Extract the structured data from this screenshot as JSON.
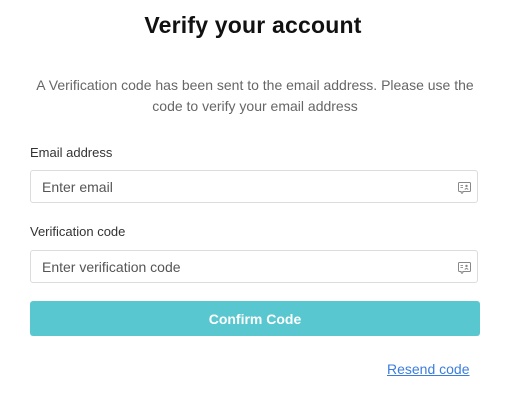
{
  "page": {
    "title": "Verify your account",
    "description": "A Verification code has been sent to the email address. Please use the code to verify your email address"
  },
  "form": {
    "email": {
      "label": "Email address",
      "placeholder": "Enter email",
      "value": "",
      "icon": "contact-card-icon"
    },
    "code": {
      "label": "Verification code",
      "placeholder": "Enter verification code",
      "value": "",
      "icon": "contact-card-icon"
    },
    "confirm_label": "Confirm Code",
    "resend_label": "Resend code"
  },
  "colors": {
    "accent": "#58c7cf",
    "link": "#3b7ddd",
    "border": "#dcdcdc"
  }
}
